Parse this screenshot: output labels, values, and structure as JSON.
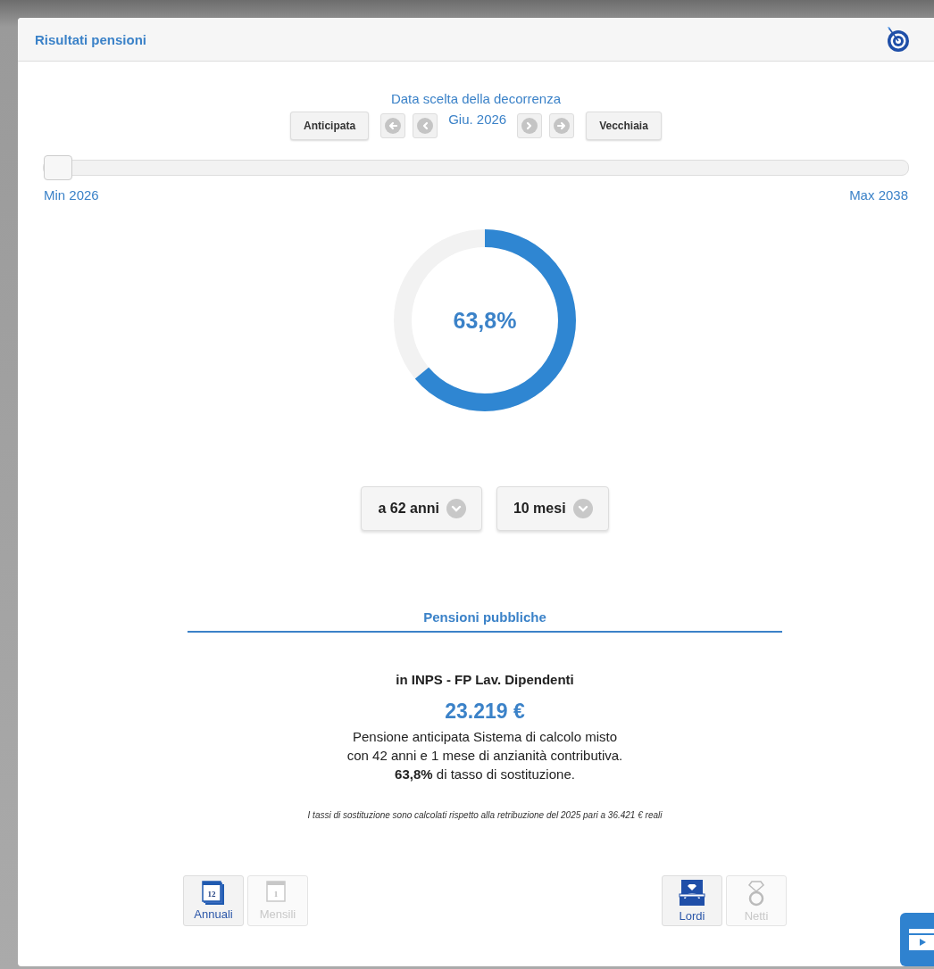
{
  "header": {
    "title": "Risultati pensioni"
  },
  "date_picker": {
    "label": "Data scelta della decorrenza",
    "early_button": "Anticipata",
    "value": "Giu. 2026",
    "old_age_button": "Vecchiaia"
  },
  "slider": {
    "level": 0,
    "min_label": "Min 2026",
    "max_label": "Max 2038"
  },
  "gauge": {
    "value": "63,8%"
  },
  "dropdowns": [
    {
      "value": "a 62 anni"
    },
    {
      "value": "10 mesi"
    }
  ],
  "section": {
    "title": "Pensioni pubbliche"
  },
  "pension": {
    "fund": "in INPS - FP Lav. Dipendenti",
    "amount": "23.219 €",
    "description": [
      "Pensione anticipata Sistema di calcolo misto",
      "con 42 anni e 1 mese di anzianità contributiva.",
      "**63,8%** di tasso di sostituzione."
    ],
    "footnote": "I tassi di sostituzione sono calcolati rispetto alla retribuzione del 2025 pari a 36.421 € reali"
  },
  "period_toggle": [
    {
      "label": "Annuali",
      "icon_text": "12",
      "selected": true
    },
    {
      "label": "Mensili",
      "icon_text": "1",
      "selected": false
    }
  ],
  "amount_toggle": [
    {
      "kind": "ring-box",
      "label": "Lordi",
      "selected": true
    },
    {
      "kind": "ring",
      "label": "Netti",
      "selected": false
    }
  ]
}
